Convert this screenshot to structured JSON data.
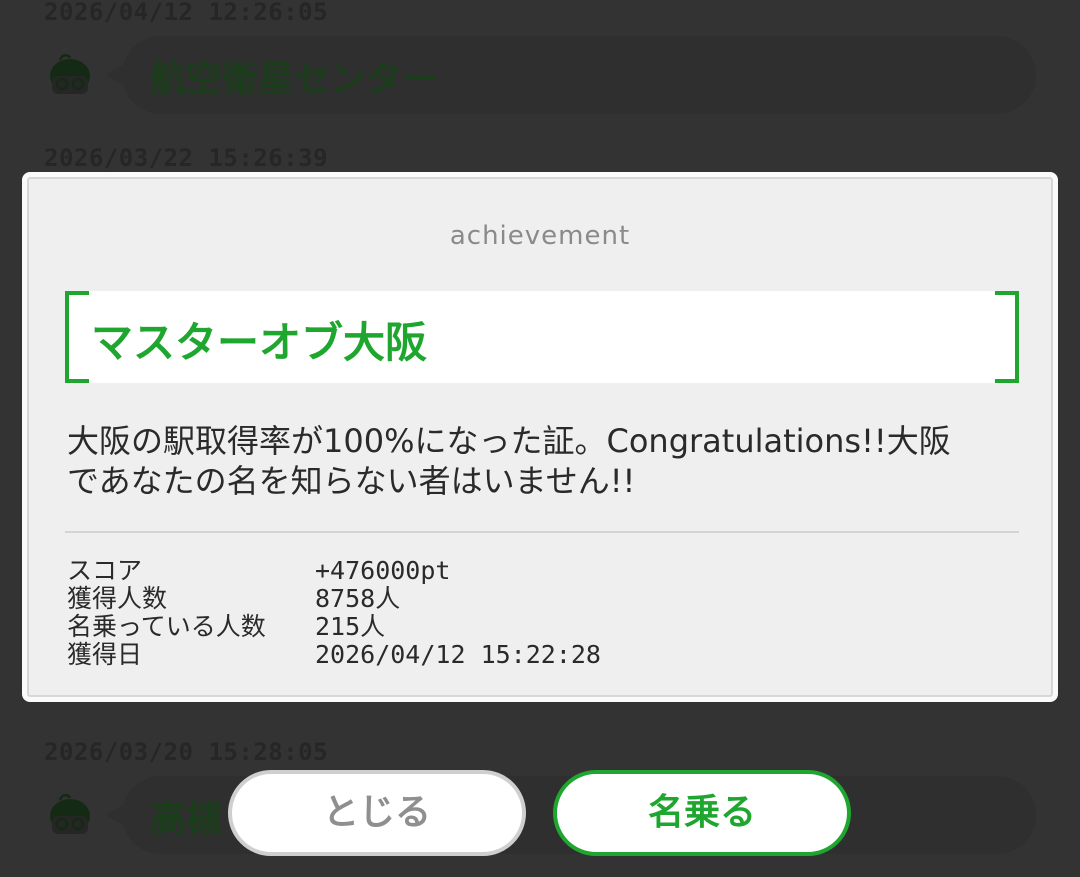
{
  "background": {
    "items": [
      {
        "timestamp": "2026/04/12 12:26:05",
        "title": "航空衛星センター"
      },
      {
        "timestamp": "2026/03/22 15:26:39",
        "title": ""
      },
      {
        "timestamp": "2026/03/20 15:28:05",
        "title": "高槻"
      }
    ]
  },
  "modal": {
    "header": "achievement",
    "title": "マスターオブ大阪",
    "description_line1": "大阪の駅取得率が100%になった証。Congratulations!!大阪",
    "description_line2": "であなたの名を知らない者はいません!!",
    "stats": [
      {
        "label": "スコア",
        "value": "+476000pt"
      },
      {
        "label": "獲得人数",
        "value": "8758人"
      },
      {
        "label": "名乗っている人数",
        "value": "215人"
      },
      {
        "label": "獲得日",
        "value": "2026/04/12 15:22:28"
      }
    ]
  },
  "buttons": {
    "close_label": "とじる",
    "name_label": "名乗る"
  },
  "colors": {
    "accent": "#1ea62f",
    "overlay_bg": "#333333",
    "modal_bg": "#efefef"
  }
}
